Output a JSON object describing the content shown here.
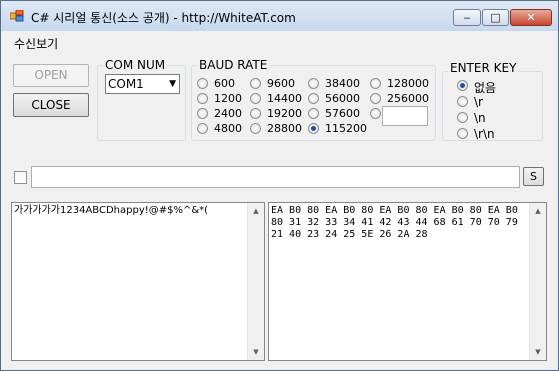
{
  "window": {
    "title": "C# 시리얼 통신(소스 공개) - http://WhiteAT.com",
    "controls": {
      "minimize": "‒",
      "maximize": "□",
      "close": "✕"
    }
  },
  "menu": {
    "items": [
      "수신보기"
    ]
  },
  "buttons": {
    "open": "OPEN",
    "close": "CLOSE",
    "send": "S"
  },
  "com_num": {
    "label": "COM NUM",
    "value": "COM1"
  },
  "baud_rate": {
    "label": "BAUD RATE",
    "options": [
      "600",
      "1200",
      "2400",
      "4800",
      "9600",
      "14400",
      "19200",
      "28800",
      "38400",
      "56000",
      "57600",
      "115200",
      "128000",
      "256000"
    ],
    "selected": "115200",
    "custom_value": ""
  },
  "enter_key": {
    "label": "ENTER KEY",
    "options": [
      "없음",
      "\\r",
      "\\n",
      "\\r\\n"
    ],
    "selected": "없음"
  },
  "send_input": {
    "value": ""
  },
  "send_checkbox": {
    "checked": false
  },
  "text_view": {
    "content": "가가가가가1234ABCDhappy!@#$%^&*("
  },
  "hex_view": {
    "content": "EA B0 80 EA B0 80 EA B0 80 EA B0 80 EA B0\n80 31 32 33 34 41 42 43 44 68 61 70 70 79\n21 40 23 24 25 5E 26 2A 28"
  },
  "colors": {
    "title_bar": "#c7d8ee",
    "close_button": "#c6462f",
    "radio_checked": "#1f4f9a"
  }
}
